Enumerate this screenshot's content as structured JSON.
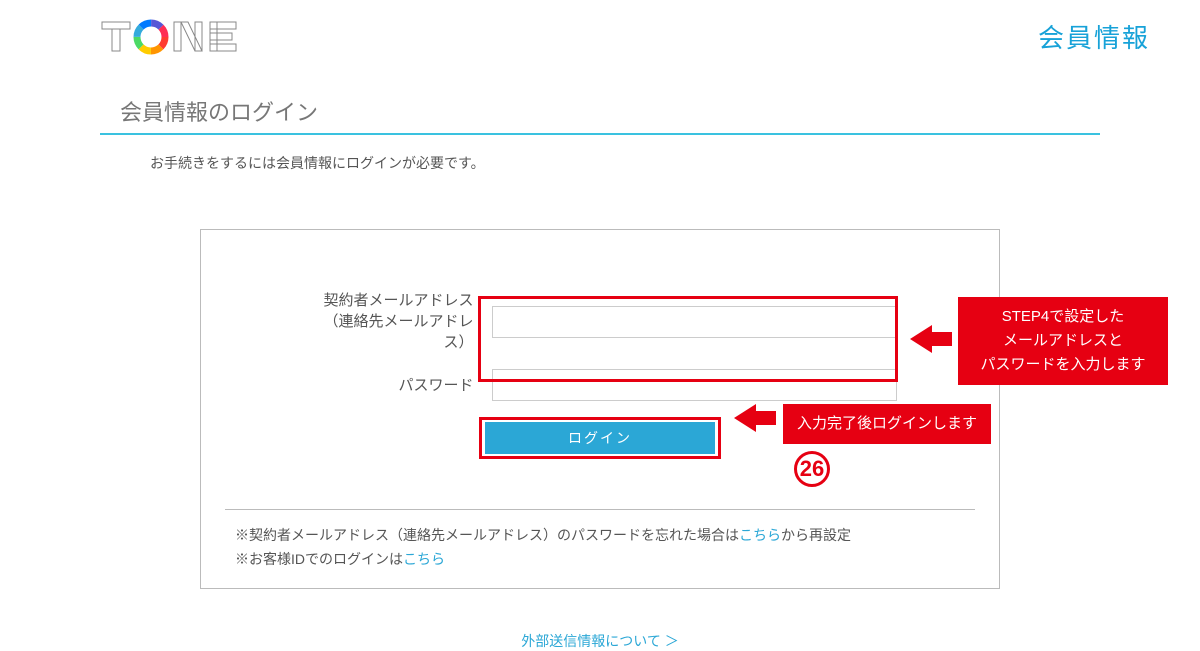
{
  "header": {
    "logo_alt": "TONE",
    "right_label": "会員情報"
  },
  "page": {
    "title": "会員情報のログイン",
    "instruction": "お手続きをするには会員情報にログインが必要です。"
  },
  "form": {
    "email_label_line1": "契約者メールアドレス",
    "email_label_line2": "（連絡先メールアドレス）",
    "password_label": "パスワード",
    "email_value": "",
    "password_value": "",
    "login_button": "ログイン"
  },
  "notes": {
    "line1_prefix": "※契約者メールアドレス（連絡先メールアドレス）のパスワードを忘れた場合は",
    "line1_link": "こちら",
    "line1_suffix": "から再設定",
    "line2_prefix": "※お客様IDでのログインは",
    "line2_link": "こちら"
  },
  "bottom_link": "外部送信情報について ＞",
  "annotations": {
    "inputs_note_line1": "STEP4で設定した",
    "inputs_note_line2": "メールアドレスと",
    "inputs_note_line3": "パスワードを入力します",
    "login_note": "入力完了後ログインします",
    "step_number": "26"
  }
}
